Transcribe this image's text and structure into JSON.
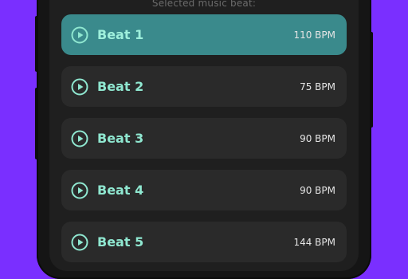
{
  "screen": {
    "header_text": "Selected music beat:"
  },
  "beats": [
    {
      "name": "Beat 1",
      "bpm": "110 BPM",
      "selected": true
    },
    {
      "name": "Beat 2",
      "bpm": "75 BPM",
      "selected": false
    },
    {
      "name": "Beat 3",
      "bpm": "90 BPM",
      "selected": false
    },
    {
      "name": "Beat 4",
      "bpm": "90 BPM",
      "selected": false
    },
    {
      "name": "Beat 5",
      "bpm": "144 BPM",
      "selected": false
    }
  ],
  "colors": {
    "background": "#7a2fff",
    "screen": "#1f1f1f",
    "item": "#2a2a2a",
    "item_selected": "#3a8a8c",
    "accent": "#8fe7d0"
  },
  "icons": {
    "play": "play-circle-icon"
  }
}
